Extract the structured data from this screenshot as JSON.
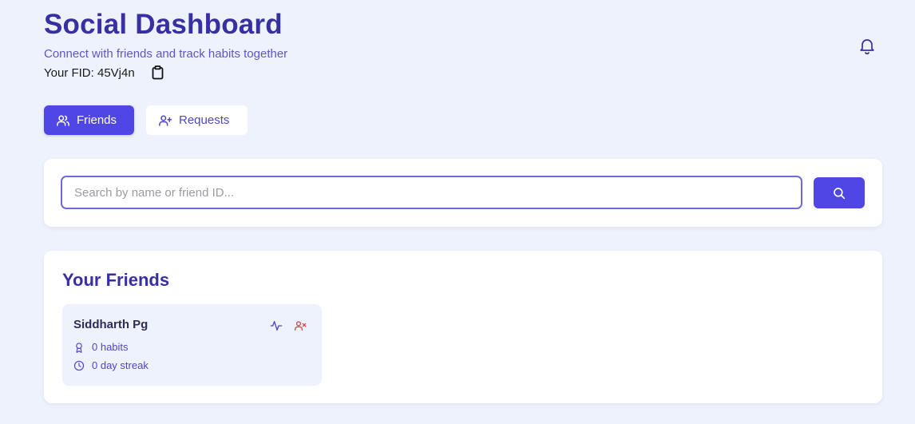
{
  "header": {
    "title": "Social Dashboard",
    "subtitle": "Connect with friends and track habits together",
    "fid_label": "Your FID: 45Vj4n",
    "copy_icon": "clipboard-icon",
    "notification_icon": "bell-icon"
  },
  "tabs": [
    {
      "label": "Friends",
      "icon": "users-icon",
      "active": true
    },
    {
      "label": "Requests",
      "icon": "user-plus-icon",
      "active": false
    }
  ],
  "search": {
    "placeholder": "Search by name or friend ID...",
    "value": "",
    "button_icon": "search-icon"
  },
  "friends_section": {
    "heading": "Your Friends",
    "friends": [
      {
        "name": "Siddharth Pg",
        "habits": "0 habits",
        "streak": "0 day streak"
      }
    ]
  },
  "colors": {
    "page_background": "#eef2fd",
    "primary": "#4f46e5",
    "heading": "#3730a3",
    "danger": "#e04545"
  }
}
